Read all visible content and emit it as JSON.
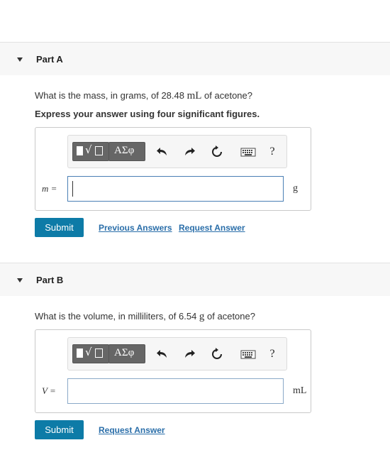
{
  "partA": {
    "title": "Part A",
    "question_pre": "What is the mass, in grams, of 28.48 ",
    "question_unit": "mL",
    "question_post": " of acetone?",
    "instruction": "Express your answer using four significant figures.",
    "variable": "m =",
    "answer_value": "",
    "unit": "g",
    "submit_label": "Submit",
    "previous_answers_label": "Previous Answers",
    "request_answer_label": "Request Answer"
  },
  "partB": {
    "title": "Part B",
    "question_pre": "What is the volume, in milliliters, of 6.54 ",
    "question_unit": "g",
    "question_post": " of acetone?",
    "variable": "V =",
    "answer_value": "",
    "unit": "mL",
    "submit_label": "Submit",
    "request_answer_label": "Request Answer"
  },
  "toolbar": {
    "greek_label": "ΑΣφ",
    "help_label": "?",
    "icons": [
      "templates-icon",
      "greek-letters-icon",
      "undo-icon",
      "redo-icon",
      "reset-icon",
      "keyboard-icon",
      "help-icon"
    ]
  },
  "colors": {
    "submit_bg": "#0d7ba7",
    "link": "#2a6ea9",
    "input_border": "#4a7fb5",
    "header_bg": "#f7f7f7"
  }
}
